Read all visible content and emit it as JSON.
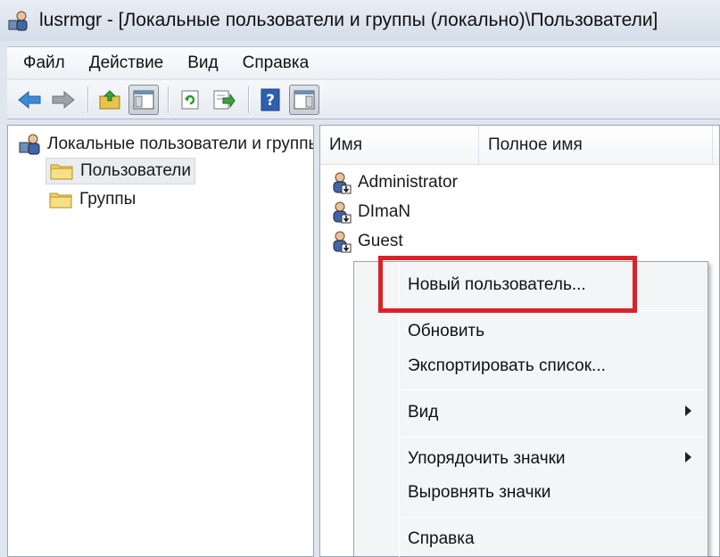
{
  "window": {
    "title": "lusrmgr - [Локальные пользователи и группы (локально)\\Пользователи]"
  },
  "menubar": {
    "items": [
      "Файл",
      "Действие",
      "Вид",
      "Справка"
    ]
  },
  "toolbar": {
    "icons": [
      "back-arrow-icon",
      "forward-arrow-icon",
      "up-folder-icon",
      "show-hide-tree-icon",
      "refresh-icon",
      "export-list-icon",
      "help-icon",
      "action-pane-icon"
    ]
  },
  "tree": {
    "root_label": "Локальные пользователи и группы",
    "items": [
      {
        "label": "Пользователи",
        "selected": true
      },
      {
        "label": "Группы",
        "selected": false
      }
    ]
  },
  "list": {
    "columns": [
      "Имя",
      "Полное имя"
    ],
    "users": [
      "Administrator",
      "DImaN",
      "Guest"
    ]
  },
  "context_menu": {
    "items": [
      {
        "label": "Новый пользователь...",
        "submenu": false
      },
      {
        "label": "Обновить",
        "submenu": false
      },
      {
        "label": "Экспортировать список...",
        "submenu": false
      },
      {
        "label": "Вид",
        "submenu": true
      },
      {
        "label": "Упорядочить значки",
        "submenu": true
      },
      {
        "label": "Выровнять значки",
        "submenu": false
      },
      {
        "label": "Справка",
        "submenu": false
      }
    ]
  },
  "colors": {
    "highlight": "#d9222a",
    "accent_blue": "#2f6fc3"
  }
}
